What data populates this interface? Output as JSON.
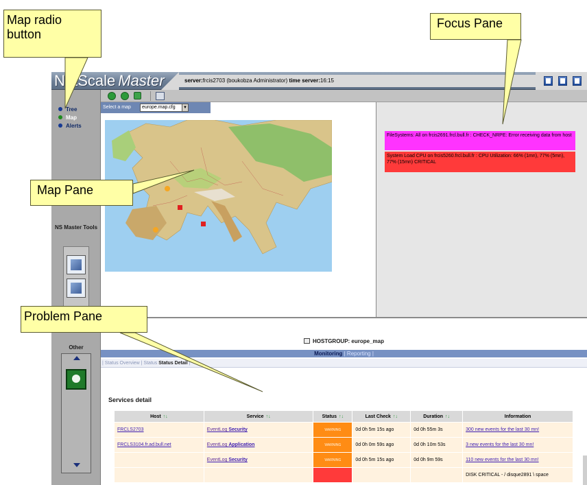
{
  "callouts": {
    "map_radio": "Map radio button",
    "focus_pane": "Focus Pane",
    "map_pane": "Map Pane",
    "problem_pane": "Problem Pane"
  },
  "header": {
    "logo_prefix": "NetScale",
    "logo_suffix": "Master",
    "server_label": "server:",
    "server_value": "frcis2703 (boukobza Administrator)",
    "time_label": "time server:",
    "time_value": "16:15"
  },
  "sidebar": {
    "radios": [
      {
        "label": "Tree",
        "active": false
      },
      {
        "label": "Map",
        "active": true
      },
      {
        "label": "Alerts",
        "active": false
      }
    ],
    "tools_title": "NS Master Tools",
    "other_title": "Other"
  },
  "map": {
    "select_label": "Select a map",
    "select_value": "europe.map.cfg"
  },
  "focus": {
    "alerts": [
      {
        "text": "FileSystems: All on frcis2691.frcl.bull.fr : CHECK_NRPE: Error receiving data from host",
        "color": "#ff33ff"
      },
      {
        "text": "System Load CPU on frcis5260.frcl.bull.fr : CPU Utilization: 66% (1mn), 77% (5mn), 77% (15mn) CRITICAL",
        "color": "#ff3a3a"
      }
    ]
  },
  "problem": {
    "hostgroup": "HOSTGROUP: europe_map",
    "mon_active": "Monitoring",
    "mon_inactive": "| Reporting |",
    "subnav_prefix": "| Status Overview | Status",
    "subnav_active": "Status Detail",
    "subnav_suffix": "|",
    "services_title": "Services detail",
    "columns": [
      "Host",
      "Service",
      "Status",
      "Last Check",
      "Duration",
      "Information"
    ],
    "rows": [
      {
        "host": "FRCLS2703",
        "svc_a": "EventLog ",
        "svc_b": "Security",
        "status": "WARNING",
        "last": "0d 0h 5m 15s ago",
        "duration": "0d 0h 55m 3s",
        "info": "300 new events for the last 30 mn!"
      },
      {
        "host": "FRCLS3104.fr.ad.bull.net",
        "svc_a": "EventLog ",
        "svc_b": "Application",
        "status": "WARNING",
        "last": "0d 0h 0m 59s ago",
        "duration": "0d 0h 10m 53s",
        "info": "3 new events for the last 30 mn!"
      },
      {
        "host": "",
        "svc_a": "EventLog ",
        "svc_b": "Security",
        "status": "WARNING",
        "last": "0d 0h 5m 15s ago",
        "duration": "0d 0h 9m 59s",
        "info": "110 new events for the last 30 mn!"
      },
      {
        "host": "",
        "svc_a": "",
        "svc_b": "",
        "status": "",
        "last": "",
        "duration": "",
        "info": "DISK CRITICAL - / disque2891 \\ space"
      }
    ]
  },
  "colors": {
    "warning": "#ff8c14",
    "critical": "#ff3a3a",
    "callout": "#ffffa6",
    "marker_orange": "#f5a623",
    "marker_red": "#e02020"
  }
}
